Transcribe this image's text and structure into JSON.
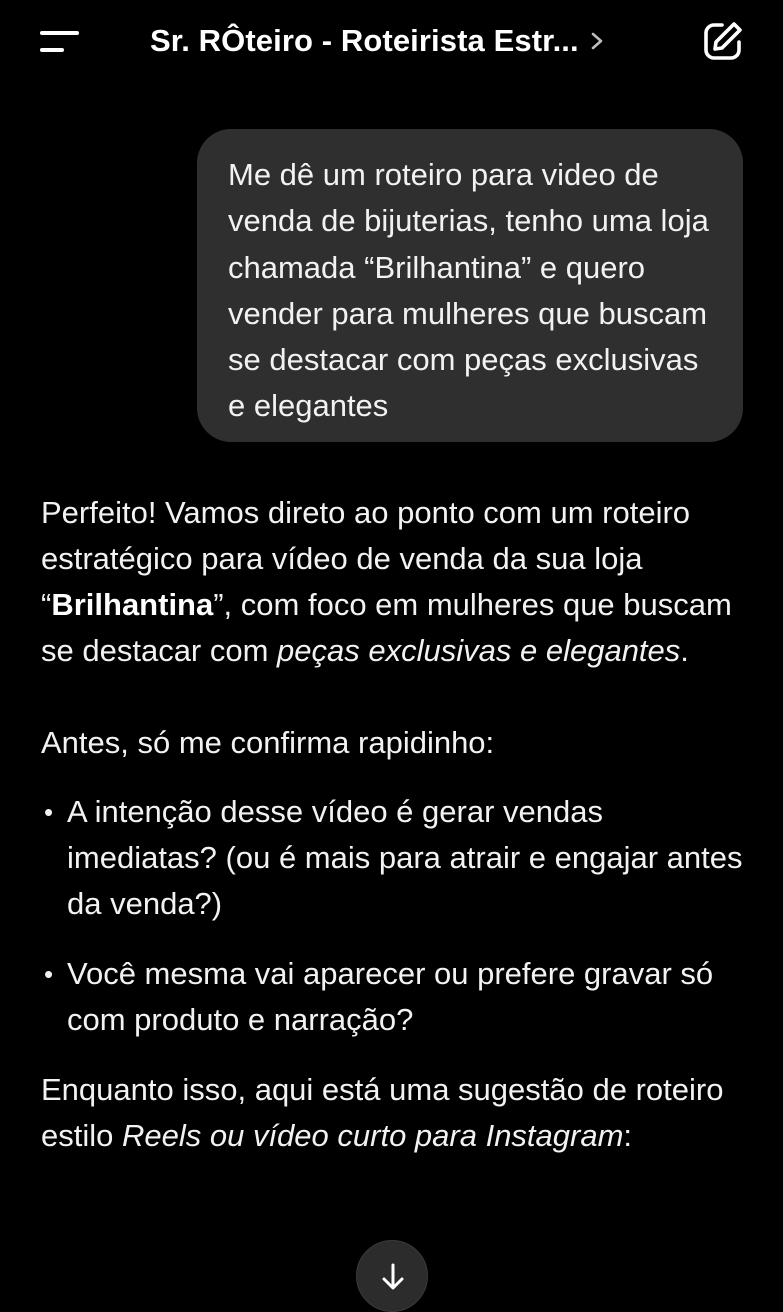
{
  "header": {
    "title": "Sr. RÔteiro - Roteirista Estr...",
    "menu_icon": "menu-icon",
    "chevron_icon": "chevron-right-icon",
    "edit_icon": "new-chat-edit-icon"
  },
  "user_message": {
    "text": "Me dê um roteiro para video de venda de bijuterias, tenho uma loja chamada “Brilhantina” e quero vender para mulheres que buscam se destacar com peças exclusivas e elegantes"
  },
  "assistant_message": {
    "intro": {
      "part1": "Perfeito! Vamos direto ao ponto com um roteiro estratégico para vídeo de venda da sua loja “",
      "brand": "Brilhantina",
      "part2": "”, com foco em mulheres que buscam se destacar com ",
      "emphasis": "peças exclusivas e elegantes",
      "part3": "."
    },
    "question_lead": "Antes, só me confirma rapidinho:",
    "bullets": [
      "A intenção desse vídeo é gerar vendas imediatas? (ou é mais para atrair e engajar antes da venda?)",
      "Você mesma vai aparecer ou prefere gravar só com produto e narração?"
    ],
    "closing": {
      "part1": "Enquanto isso, aqui está uma sugestão de roteiro estilo ",
      "emphasis": "Reels ou vídeo curto para Instagram",
      "part2": ":"
    }
  },
  "scroll_button": {
    "icon": "arrow-down-icon"
  },
  "colors": {
    "background": "#000000",
    "bubble": "#2f2f2f",
    "text": "#f2f2f2"
  }
}
